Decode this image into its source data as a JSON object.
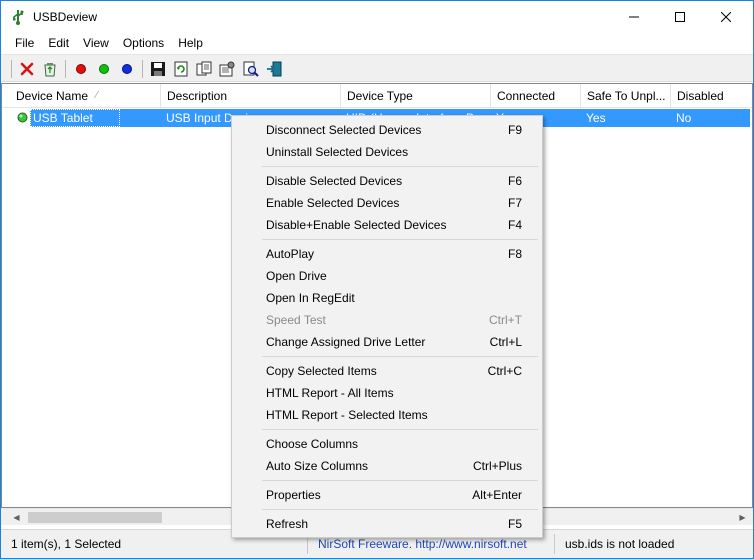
{
  "window": {
    "title": "USBDeview"
  },
  "menubar": [
    "File",
    "Edit",
    "View",
    "Options",
    "Help"
  ],
  "toolbar": {
    "buttons": [
      "close-icon",
      "uninstall-icon",
      "red-dot-icon",
      "green-dot-icon",
      "blue-dot-icon",
      "save-icon",
      "refresh-icon",
      "copy-icon",
      "properties-icon",
      "find-icon",
      "exit-icon"
    ]
  },
  "columns": [
    "Device Name",
    "Description",
    "Device Type",
    "Connected",
    "Safe To Unpl...",
    "Disabled"
  ],
  "rows": [
    {
      "device_name": "USB Tablet",
      "description": "USB Input Device",
      "device_type": "HID (Human Interface D...",
      "connected": "Yes",
      "safe_to_unplug": "Yes",
      "disabled": "No"
    }
  ],
  "context_menu": [
    {
      "label": "Disconnect Selected Devices",
      "key": "F9",
      "enabled": true
    },
    {
      "label": "Uninstall Selected Devices",
      "key": "",
      "enabled": true
    },
    {
      "label": "Disable Selected Devices",
      "key": "F6",
      "enabled": true
    },
    {
      "label": "Enable Selected Devices",
      "key": "F7",
      "enabled": true
    },
    {
      "label": "Disable+Enable Selected Devices",
      "key": "F4",
      "enabled": true
    },
    {
      "label": "AutoPlay",
      "key": "F8",
      "enabled": true
    },
    {
      "label": "Open Drive",
      "key": "",
      "enabled": true
    },
    {
      "label": "Open In RegEdit",
      "key": "",
      "enabled": true
    },
    {
      "label": "Speed Test",
      "key": "Ctrl+T",
      "enabled": false
    },
    {
      "label": "Change Assigned Drive Letter",
      "key": "Ctrl+L",
      "enabled": true
    },
    {
      "label": "Copy Selected Items",
      "key": "Ctrl+C",
      "enabled": true
    },
    {
      "label": "HTML Report - All Items",
      "key": "",
      "enabled": true
    },
    {
      "label": "HTML Report - Selected Items",
      "key": "",
      "enabled": true
    },
    {
      "label": "Choose Columns",
      "key": "",
      "enabled": true
    },
    {
      "label": "Auto Size Columns",
      "key": "Ctrl+Plus",
      "enabled": true
    },
    {
      "label": "Properties",
      "key": "Alt+Enter",
      "enabled": true
    },
    {
      "label": "Refresh",
      "key": "F5",
      "enabled": true
    }
  ],
  "statusbar": {
    "count": "1 item(s), 1 Selected",
    "credit": "NirSoft Freeware.  http://www.nirsoft.net",
    "usbids": "usb.ids is not loaded"
  },
  "colors": {
    "selection": "#3399ff",
    "accent": "#1883d7",
    "menu_bg": "#f2f2f2",
    "link": "#1f46b8"
  }
}
